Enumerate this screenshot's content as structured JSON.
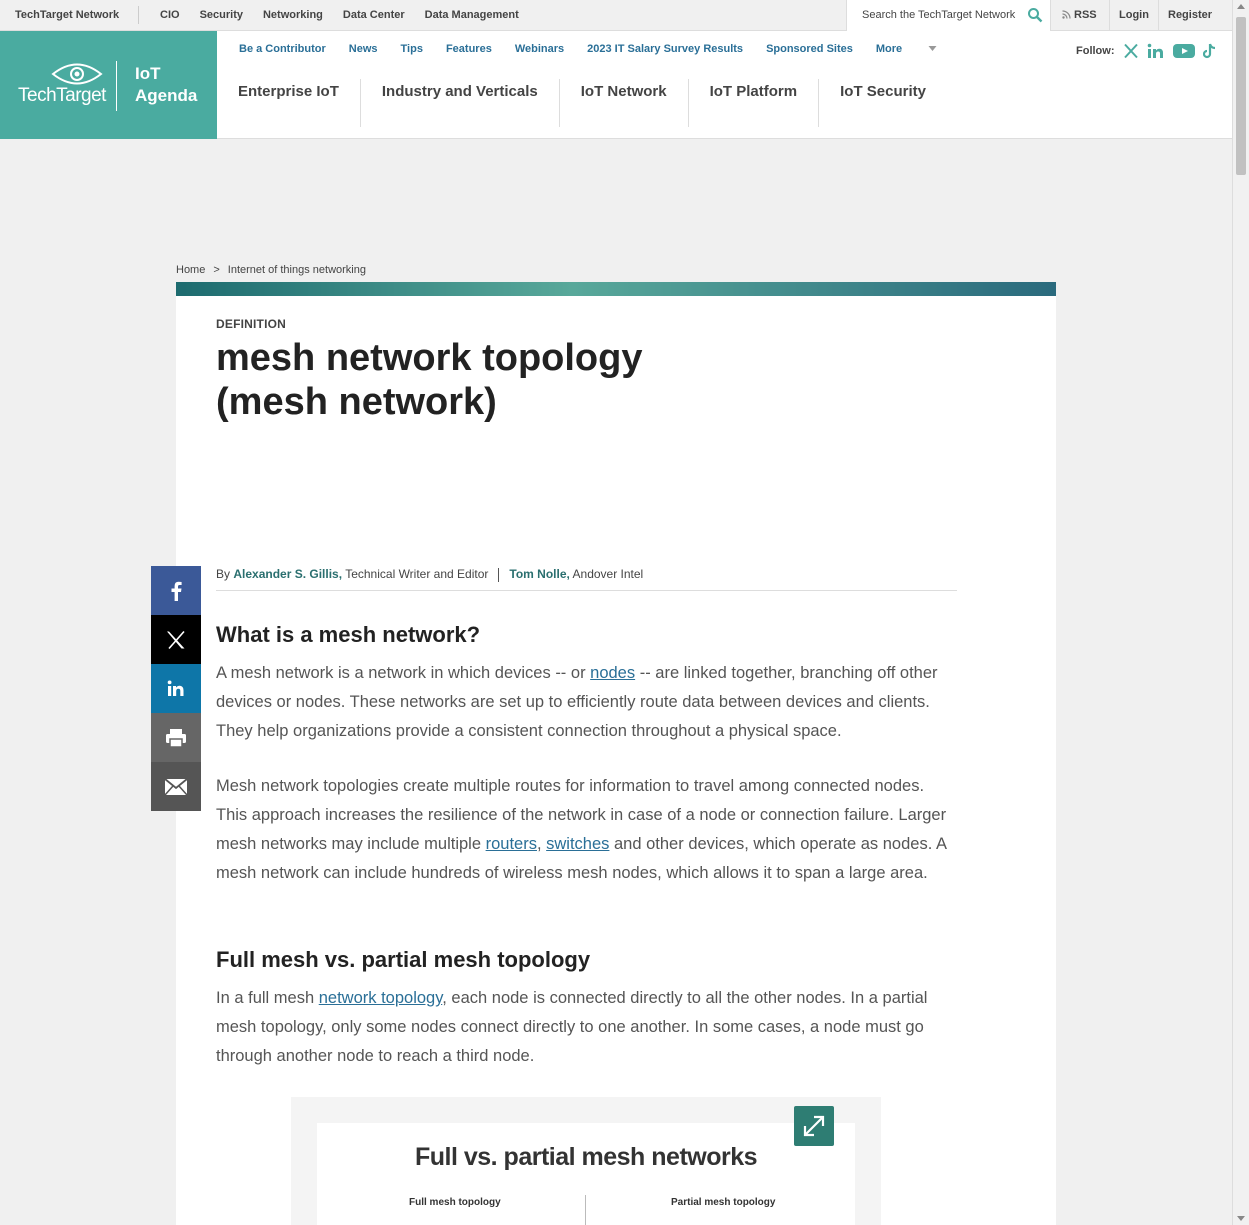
{
  "topbar": {
    "brand": "TechTarget Network",
    "sites": [
      "CIO",
      "Security",
      "Networking",
      "Data Center",
      "Data Management"
    ],
    "search_placeholder": "Search the TechTarget Network",
    "rss": "RSS",
    "login": "Login",
    "register": "Register"
  },
  "logo": {
    "company": "TechTarget",
    "site_line1": "IoT",
    "site_line2": "Agenda",
    "color": "#4aaba0"
  },
  "subnav": [
    "Be a Contributor",
    "News",
    "Tips",
    "Features",
    "Webinars",
    "2023 IT Salary Survey Results",
    "Sponsored Sites",
    "More"
  ],
  "follow_label": "Follow:",
  "social_icons": [
    "x-icon",
    "linkedin-icon",
    "youtube-icon",
    "tiktok-icon"
  ],
  "mainnav": [
    "Enterprise IoT",
    "Industry and Verticals",
    "IoT Network",
    "IoT Platform",
    "IoT Security"
  ],
  "breadcrumb": {
    "home": "Home",
    "separator": ">",
    "current": "Internet of things networking"
  },
  "article": {
    "kicker": "DEFINITION",
    "title_line1": "mesh network topology",
    "title_line2": "(mesh network)",
    "byline": {
      "by": "By",
      "author1": "Alexander S. Gillis,",
      "author1_role": "Technical Writer and Editor",
      "author2": "Tom Nolle,",
      "author2_org": "Andover Intel"
    },
    "h2_1": "What is a mesh network?",
    "p1": {
      "a": "A mesh network is a network in which devices -- or ",
      "link": "nodes",
      "b": " -- are linked together, branching off other devices or nodes. These networks are set up to efficiently route data between devices and clients. They help organizations provide a consistent connection throughout a physical space."
    },
    "p2": {
      "a": "Mesh network topologies create multiple routes for information to travel among connected nodes. This approach increases the resilience of the network in case of a node or connection failure. Larger mesh networks may include multiple ",
      "link1": "routers",
      "comma": ", ",
      "link2": "switches",
      "b": " and other devices, which operate as nodes. A mesh network can include hundreds of wireless mesh nodes, which allows it to span a large area."
    },
    "h2_2": "Full mesh vs. partial mesh topology",
    "p3": {
      "a": "In a full mesh ",
      "link": "network topology",
      "b": ", each node is connected directly to all the other nodes. In a partial mesh topology, only some nodes connect directly to one another. In some cases, a node must go through another node to reach a third node."
    },
    "figure": {
      "title": "Full vs. partial mesh networks",
      "left_label": "Full mesh topology",
      "right_label": "Partial mesh topology"
    }
  },
  "share_buttons": [
    {
      "name": "facebook-icon",
      "color": "#3b5998"
    },
    {
      "name": "x-icon",
      "color": "#000000"
    },
    {
      "name": "linkedin-icon",
      "color": "#0e76a8"
    },
    {
      "name": "print-icon",
      "color": "#666666"
    },
    {
      "name": "email-icon",
      "color": "#555555"
    }
  ]
}
